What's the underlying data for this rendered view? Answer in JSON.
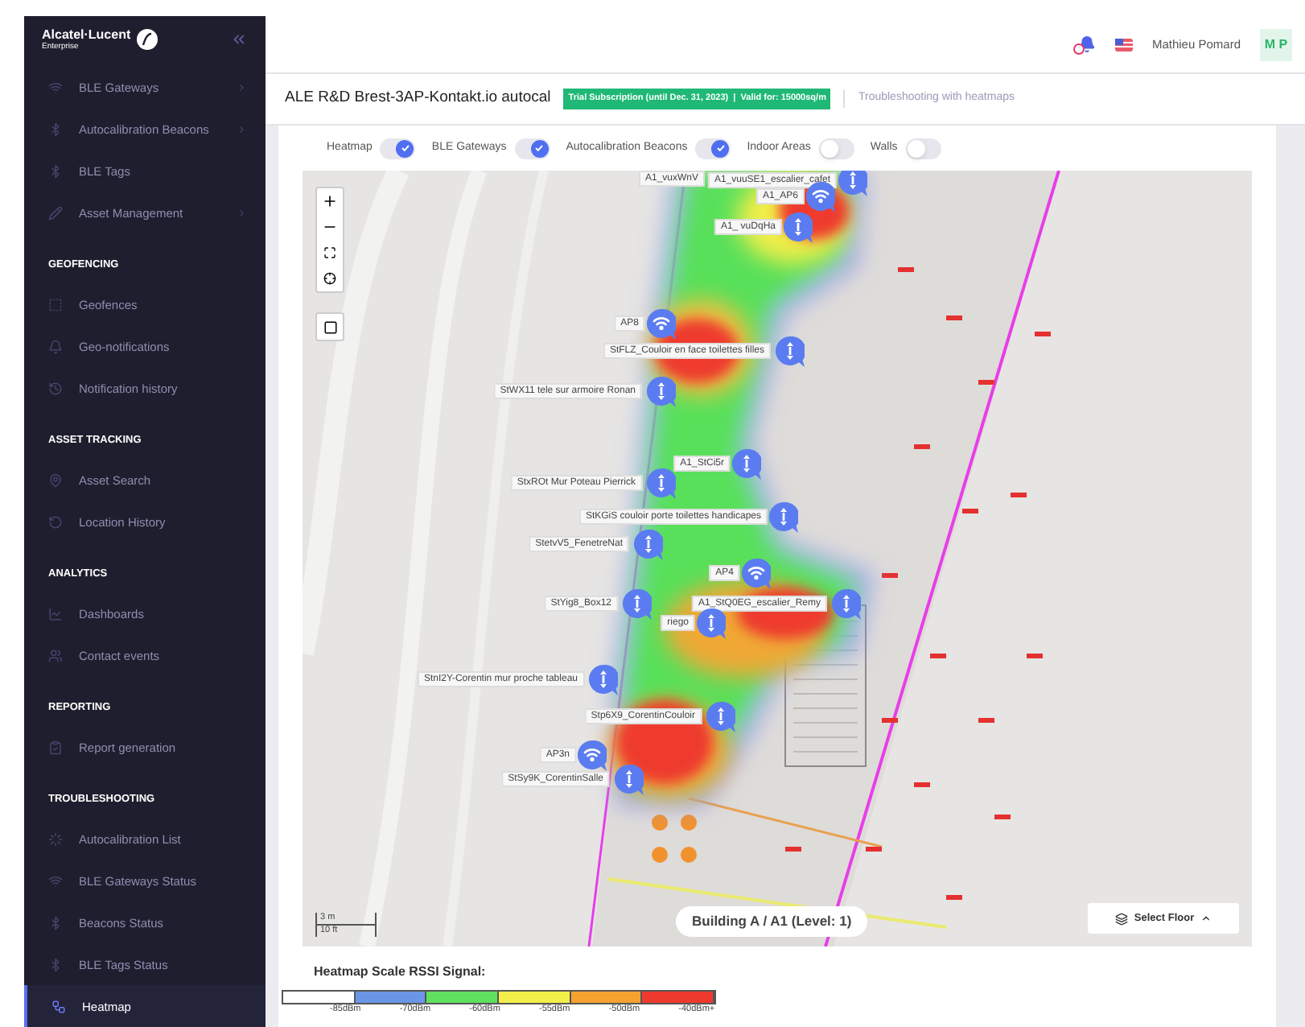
{
  "brand": {
    "name": "Alcatel·Lucent",
    "tagline": "Enterprise"
  },
  "sidebar": {
    "sections": [
      {
        "items": [
          {
            "label": "BLE Gateways",
            "expandable": true,
            "selected": false
          },
          {
            "label": "Autocalibration Beacons",
            "expandable": true,
            "selected": false
          },
          {
            "label": "BLE Tags",
            "expandable": false,
            "selected": false
          },
          {
            "label": "Asset Management",
            "expandable": true,
            "selected": false
          }
        ]
      },
      {
        "heading": "GEOFENCING",
        "items": [
          {
            "label": "Geofences",
            "expandable": false,
            "selected": false
          },
          {
            "label": "Geo-notifications",
            "expandable": false,
            "selected": false
          },
          {
            "label": "Notification history",
            "expandable": false,
            "selected": false
          }
        ]
      },
      {
        "heading": "ASSET TRACKING",
        "items": [
          {
            "label": "Asset Search",
            "expandable": false,
            "selected": false
          },
          {
            "label": "Location History",
            "expandable": false,
            "selected": false
          }
        ]
      },
      {
        "heading": "ANALYTICS",
        "items": [
          {
            "label": "Dashboards",
            "expandable": false,
            "selected": false
          },
          {
            "label": "Contact events",
            "expandable": false,
            "selected": false
          }
        ]
      },
      {
        "heading": "REPORTING",
        "items": [
          {
            "label": "Report generation",
            "expandable": false,
            "selected": false
          }
        ]
      },
      {
        "heading": "TROUBLESHOOTING",
        "items": [
          {
            "label": "Autocalibration List",
            "expandable": false,
            "selected": false
          },
          {
            "label": "BLE Gateways Status",
            "expandable": false,
            "selected": false
          },
          {
            "label": "Beacons Status",
            "expandable": false,
            "selected": false
          },
          {
            "label": "BLE Tags Status",
            "expandable": false,
            "selected": false
          },
          {
            "label": "Heatmap",
            "expandable": false,
            "selected": true
          }
        ]
      }
    ]
  },
  "header": {
    "user": "Mathieu Pomard",
    "initials": "M P"
  },
  "title_bar": {
    "site": "ALE R&D Brest-3AP-Kontakt.io autocal",
    "subscription": "Trial Subscription (until Dec. 31, 2023)  |  Valid for: 15000sq/m",
    "page": "Troubleshooting with heatmaps"
  },
  "toggles": [
    {
      "label": "Heatmap",
      "on": true
    },
    {
      "label": "BLE Gateways",
      "on": true
    },
    {
      "label": "Autocalibration Beacons",
      "on": true
    },
    {
      "label": "Indoor Areas",
      "on": false
    },
    {
      "label": "Walls",
      "on": false
    }
  ],
  "map": {
    "markers": [
      {
        "label": "A1_vuxWnV",
        "kind": "label"
      },
      {
        "label": "A1_vuuSE1_escalier_cafet",
        "kind": "beacon"
      },
      {
        "label": "A1_AP6",
        "kind": "gateway"
      },
      {
        "label": "A1_ vuDqHa",
        "kind": "beacon"
      },
      {
        "label": "AP8",
        "kind": "gateway"
      },
      {
        "label": "StFLZ_Couloir en face toilettes filles",
        "kind": "beacon"
      },
      {
        "label": "StWX11 tele sur armoire Ronan",
        "kind": "beacon"
      },
      {
        "label": "A1_StCi5r",
        "kind": "beacon"
      },
      {
        "label": "StxROt Mur Poteau Pierrick",
        "kind": "beacon"
      },
      {
        "label": "StKGiS couloir porte toilettes handicapes",
        "kind": "beacon"
      },
      {
        "label": "StetvV5_FenetreNat",
        "kind": "beacon"
      },
      {
        "label": "AP4",
        "kind": "gateway"
      },
      {
        "label": "StYig8_Box12",
        "kind": "beacon"
      },
      {
        "label": "A1_StQ0EG_escalier_Remy",
        "kind": "beacon"
      },
      {
        "label": "riego",
        "kind": "beacon"
      },
      {
        "label": "StnI2Y-Corentin mur proche tableau",
        "kind": "beacon"
      },
      {
        "label": "Stp6X9_CorentinCouloir",
        "kind": "beacon"
      },
      {
        "label": "AP3n",
        "kind": "gateway"
      },
      {
        "label": "StSy9K_CorentinSalle",
        "kind": "beacon"
      }
    ],
    "scale": [
      "3 m",
      "10 ft"
    ],
    "floor": "Building A / A1 (Level: 1)",
    "select_floor": "Select Floor"
  },
  "legend": {
    "title": "Heatmap Scale RSSI Signal:",
    "segments": [
      {
        "color": "#ffffff"
      },
      {
        "color": "#6b96e8"
      },
      {
        "color": "#5fe05f"
      },
      {
        "color": "#f2ef4a"
      },
      {
        "color": "#f5a231"
      },
      {
        "color": "#ee3a2e"
      }
    ],
    "labels": [
      "-85dBm",
      "-70dBm",
      "-60dBm",
      "-55dBm",
      "-50dBm",
      "-40dBm+"
    ]
  }
}
